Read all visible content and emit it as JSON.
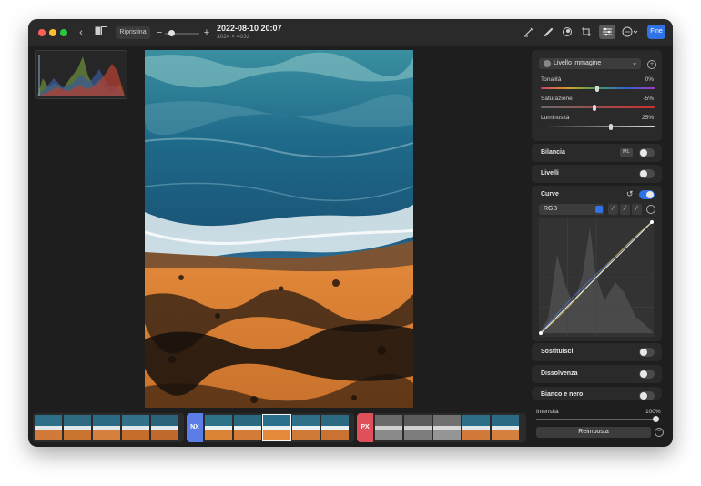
{
  "toolbar": {
    "back_icon": "chevron-left-icon",
    "compare_icon": "split-view-icon",
    "reset_label": "Ripristina",
    "zoom_minus": "−",
    "zoom_plus": "+",
    "date": "2022-08-10 20:07",
    "dimensions": "3024 × 4032",
    "done_label": "Fine",
    "icons": [
      "markup-icon",
      "retouch-icon",
      "red-eye-icon",
      "crop-icon",
      "adjust-icon",
      "more-icon"
    ]
  },
  "panel": {
    "layer_label": "Livello immagine",
    "adjustments": [
      {
        "label": "Tonalità",
        "value": "0%"
      },
      {
        "label": "Saturazione",
        "value": "-5%"
      },
      {
        "label": "Luminosità",
        "value": "25%"
      }
    ],
    "sections": {
      "bilancia": "Bilancia",
      "bilancia_badge": "ML",
      "livelli": "Livelli",
      "curve": "Curve",
      "curve_channel": "RGB",
      "sostituisci": "Sostituisci",
      "dissolvenza": "Dissolvenza",
      "bianco_nero": "Bianco e nero"
    },
    "intensity_label": "Intensità",
    "intensity_value": "100%",
    "reset_button": "Reimposta"
  },
  "filmstrip": {
    "group_badges": [
      "NX",
      "PX"
    ],
    "badge_colors": [
      "#5b7de8",
      "#e0505a"
    ]
  }
}
